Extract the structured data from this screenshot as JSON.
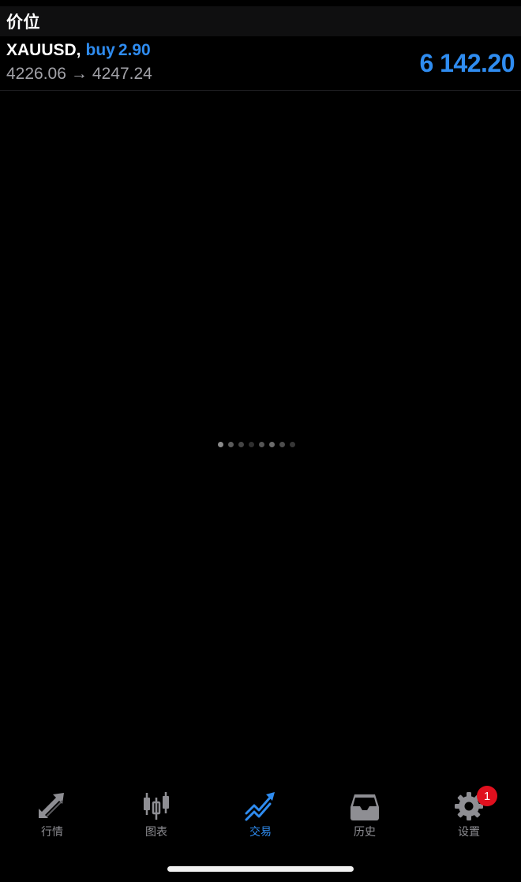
{
  "header": {
    "title": "价位"
  },
  "position": {
    "symbol": "XAUUSD,",
    "side": "buy",
    "volume": "2.90",
    "open_price": "4226.06",
    "arrow": "→",
    "current_price": "4247.24",
    "profit": "6 142.20"
  },
  "tabs": [
    {
      "label": "行情",
      "icon": "quotes-arrows-icon",
      "active": false
    },
    {
      "label": "图表",
      "icon": "candlestick-icon",
      "active": false
    },
    {
      "label": "交易",
      "icon": "trade-trend-icon",
      "active": true
    },
    {
      "label": "历史",
      "icon": "inbox-tray-icon",
      "active": false
    },
    {
      "label": "设置",
      "icon": "gear-icon",
      "active": false,
      "badge": "1"
    }
  ],
  "colors": {
    "accent": "#2f8cf0",
    "background": "#000000",
    "header_bg": "#0f0f10",
    "inactive": "#8e8e93",
    "badge": "#e0101e"
  }
}
